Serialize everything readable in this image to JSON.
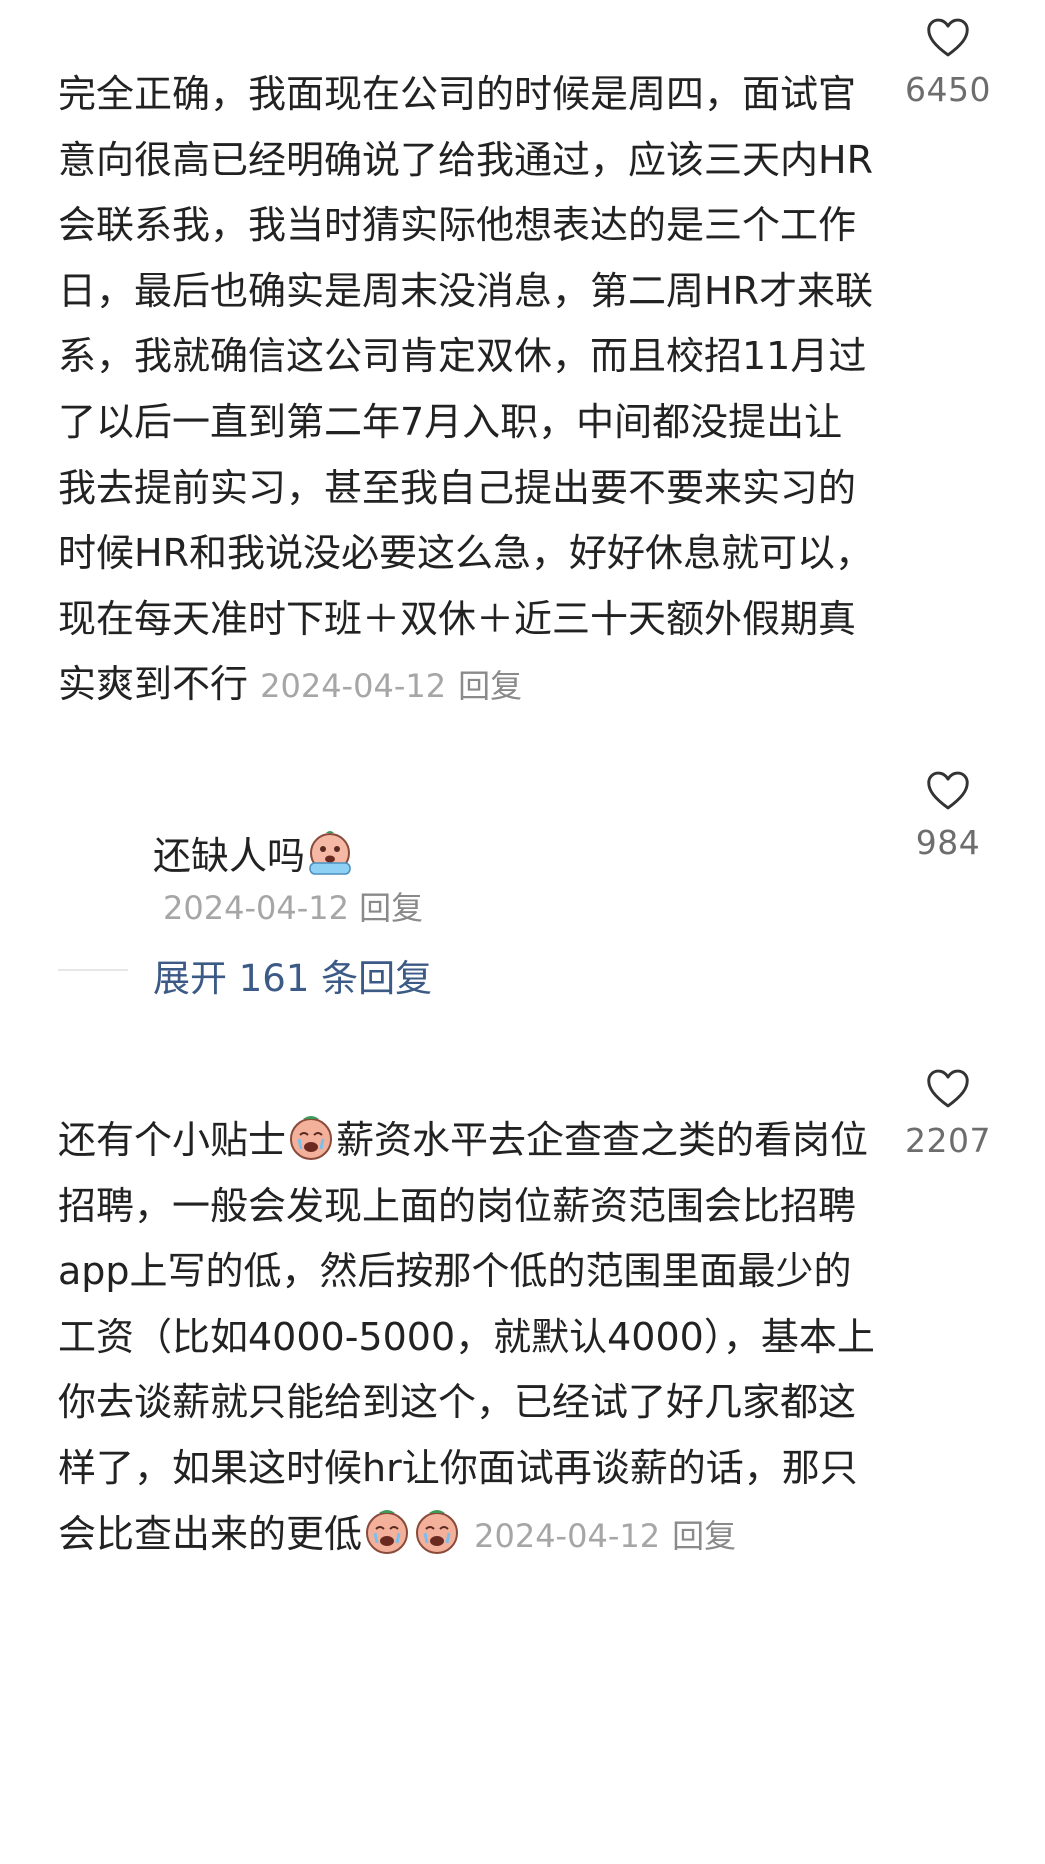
{
  "comments": [
    {
      "text": "完全正确，我面现在公司的时候是周四，面试官意向很高已经明确说了给我通过，应该三天内HR会联系我，我当时猜实际他想表达的是三个工作日，最后也确实是周末没消息，第二周HR才来联系，我就确信这公司肯定双休，而且校招11月过了以后一直到第二年7月入职，中间都没提出让我去提前实习，甚至我自己提出要不要来实习的时候HR和我说没必要这么急，好好休息就可以，现在每天准时下班＋双休＋近三十天额外假期真实爽到不行",
      "date": "2024-04-12",
      "reply": "回复",
      "likes": "6450",
      "like_icon": "heart-outline-icon"
    },
    {
      "text": "还缺人吗",
      "emoji": "crying-face-emoji",
      "date": "2024-04-12",
      "reply": "回复",
      "likes": "984",
      "like_icon": "heart-outline-icon"
    },
    {
      "text_part1": "还有个小贴士",
      "emoji": "sad-face-emoji",
      "text_part2": "薪资水平去企查查之类的看岗位招聘，一般会发现上面的岗位薪资范围会比招聘app上写的低，然后按那个低的范围里面最少的工资（比如4000-5000，就默认4000），基本上你去谈薪就只能给到这个，已经试了好几家都这样了，如果这时候hr让你面试再谈薪的话，那只会比查出来的更低",
      "emoji_count": 2,
      "date": "2024-04-12",
      "reply": "回复",
      "likes": "2207",
      "like_icon": "heart-outline-icon"
    }
  ],
  "expand": {
    "label": "展开 161 条回复"
  },
  "colors": {
    "text": "#222222",
    "meta": "#a6a6a6",
    "link": "#3b5a86",
    "like_count": "#6d6d6d"
  }
}
